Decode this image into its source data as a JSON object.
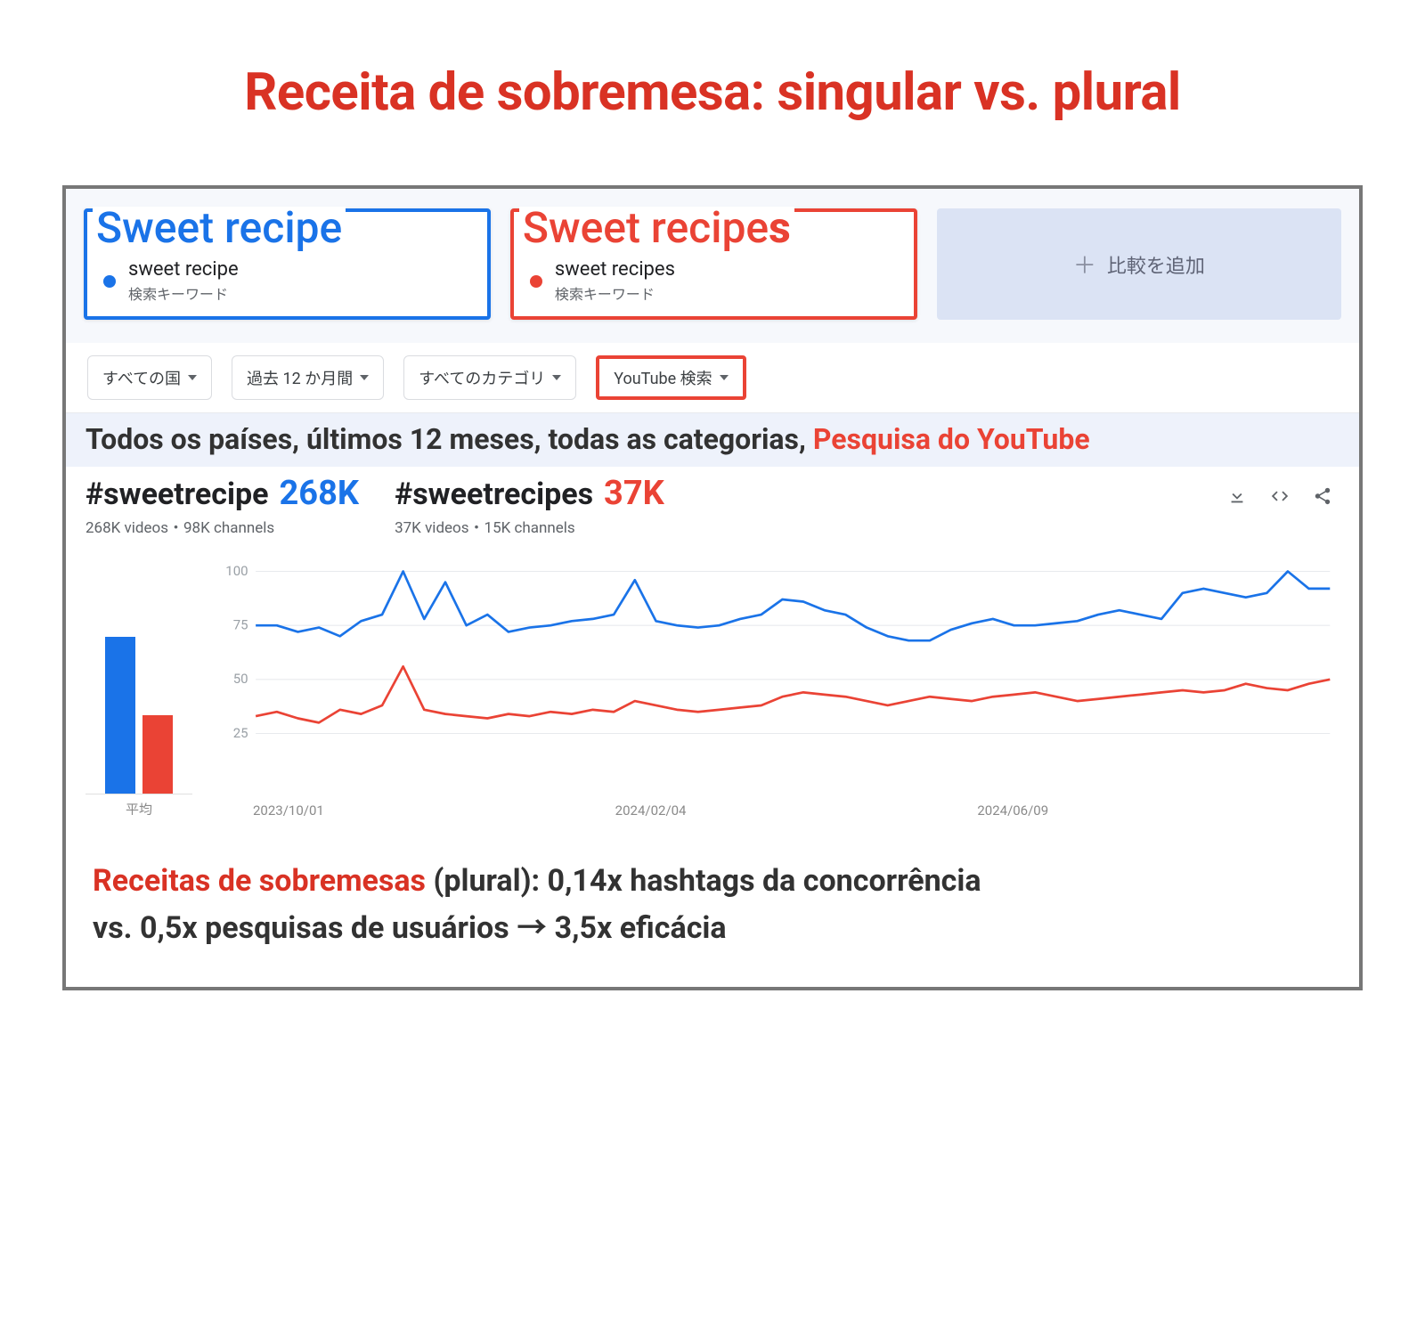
{
  "headline": "Receita de sobremesa: singular vs. plural",
  "compare": {
    "term1": {
      "overlay": "Sweet recipe",
      "term": "sweet recipe",
      "sub": "検索キーワード"
    },
    "term2": {
      "overlay_base": "Sweet recipe",
      "overlay_suffix": "s",
      "term": "sweet recipes",
      "sub": "検索キーワード"
    },
    "add_label": "比較を追加"
  },
  "filters": {
    "country": "すべての国",
    "period": "過去 12 か月間",
    "category": "すべてのカテゴリ",
    "source": "YouTube 検索"
  },
  "annotation": {
    "prefix": "Todos os países, últimos 12 meses, todas as categorias, ",
    "highlight": "Pesquisa do YouTube"
  },
  "stats": {
    "s1": {
      "tag": "#sweetrecipe",
      "count": "268K",
      "sub": "268K videos・98K channels"
    },
    "s2": {
      "tag": "#sweetrecipes",
      "count": "37K",
      "sub": "37K videos・15K channels"
    }
  },
  "avg_label": "平均",
  "x_ticks": [
    "2023/10/01",
    "2024/02/04",
    "2024/06/09"
  ],
  "conclusion": {
    "lead": "Receitas de sobremesas",
    "rest1": " (plural): 0,14x hashtags da concorrência",
    "line2": "vs. 0,5x pesquisas de usuários → 3,5x eficácia"
  },
  "chart_data": {
    "type": "line",
    "ylim": [
      0,
      100
    ],
    "y_ticks": [
      25,
      50,
      75,
      100
    ],
    "x_tick_labels": [
      "2023/10/01",
      "2024/02/04",
      "2024/06/09"
    ],
    "avg_bars": {
      "blue": 80,
      "red": 40
    },
    "series": [
      {
        "name": "sweet recipe",
        "color": "#1a73e8",
        "values": [
          75,
          75,
          72,
          74,
          70,
          77,
          80,
          100,
          78,
          95,
          75,
          80,
          72,
          74,
          75,
          77,
          78,
          80,
          96,
          77,
          75,
          74,
          75,
          78,
          80,
          87,
          86,
          82,
          80,
          74,
          70,
          68,
          68,
          73,
          76,
          78,
          75,
          75,
          76,
          77,
          80,
          82,
          80,
          78,
          90,
          92,
          90,
          88,
          90,
          100,
          92,
          92
        ]
      },
      {
        "name": "sweet recipes",
        "color": "#ea4335",
        "values": [
          33,
          35,
          32,
          30,
          36,
          34,
          38,
          56,
          36,
          34,
          33,
          32,
          34,
          33,
          35,
          34,
          36,
          35,
          40,
          38,
          36,
          35,
          36,
          37,
          38,
          42,
          44,
          43,
          42,
          40,
          38,
          40,
          42,
          41,
          40,
          42,
          43,
          44,
          42,
          40,
          41,
          42,
          43,
          44,
          45,
          44,
          45,
          48,
          46,
          45,
          48,
          50
        ]
      }
    ]
  }
}
